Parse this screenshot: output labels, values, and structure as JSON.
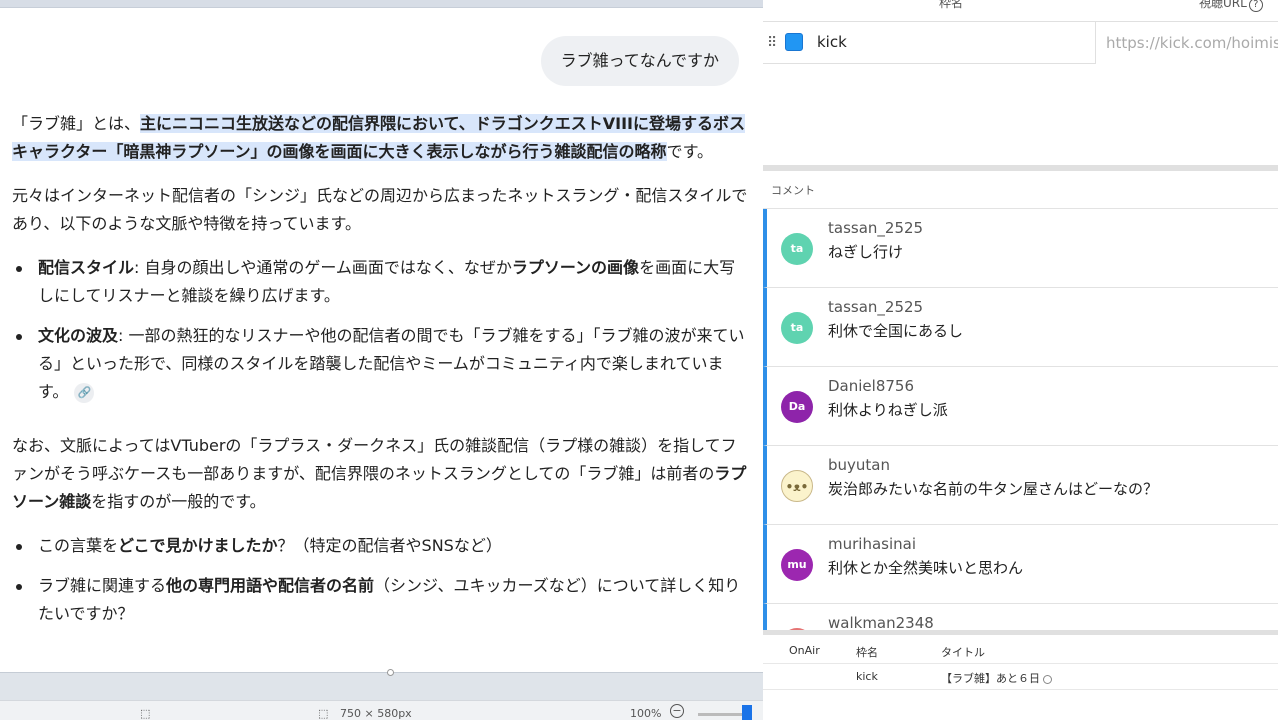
{
  "chat": {
    "user_message": "ラブ雑ってなんですか",
    "answer": {
      "p1_pre": "「ラブ雑」とは、",
      "p1_highlight": "主にニコニコ生放送などの配信界隈において、ドラゴンクエストVIIIに登場するボスキャラクター「暗黒神ラプソーン」の画像を画面に大きく表示しながら行う雑談配信の略称",
      "p1_post": "です。",
      "p2": "元々はインターネット配信者の「シンジ」氏などの周辺から広まったネットスラング・配信スタイルであり、以下のような文脈や特徴を持っています。",
      "b1_label": "配信スタイル",
      "b1_text_a": ": 自身の顔出しや通常のゲーム画面ではなく、なぜか",
      "b1_bold": "ラプソーンの画像",
      "b1_text_b": "を画面に大写しにしてリスナーと雑談を繰り広げます。",
      "b2_label": "文化の波及",
      "b2_text": ": 一部の熱狂的なリスナーや他の配信者の間でも「ラブ雑をする」「ラブ雑の波が来ている」といった形で、同様のスタイルを踏襲した配信やミームがコミュニティ内で楽しまれています。",
      "p3_a": "なお、文脈によってはVTuberの「ラプラス・ダークネス」氏の雑談配信（ラプ様の雑談）を指してファンがそう呼ぶケースも一部ありますが、配信界隈のネットスラングとしての「ラブ雑」は前者の",
      "p3_bold": "ラプソーン雑談",
      "p3_b": "を指すのが一般的です。",
      "q1_a": "この言葉を",
      "q1_bold": "どこで見かけましたか",
      "q1_b": "？（特定の配信者やSNSなど）",
      "q2_a": "ラブ雑に関連する",
      "q2_bold": "他の専門用語や配信者の名前",
      "q2_b": "（シンジ、ユキッカーズなど）について詳しく知りたいですか？"
    }
  },
  "statusbar": {
    "dimensions": "750 × 580px",
    "zoom": "100%"
  },
  "stream_tool": {
    "frame_header": {
      "name_col": "枠名",
      "url_col": "視聴URL"
    },
    "frame": {
      "name": "kick",
      "url_placeholder": "https://kick.com/hoimis"
    },
    "comment_section_label": "コメント",
    "comments": [
      {
        "user": "tassan_2525",
        "text": "ねぎし行け",
        "avatar": "ta",
        "color": "#5fd3b0"
      },
      {
        "user": "tassan_2525",
        "text": "利休で全国にあるし",
        "avatar": "ta",
        "color": "#5fd3b0"
      },
      {
        "user": "Daniel8756",
        "text": "利休よりねぎし派",
        "avatar": "Da",
        "color": "#8e24aa"
      },
      {
        "user": "buyutan",
        "text": "炭治郎みたいな名前の牛タン屋さんはどーなの？",
        "avatar": "face",
        "color": "#fbf3cc"
      },
      {
        "user": "murihasinai",
        "text": "利休とか全然美味いと思わん",
        "avatar": "mu",
        "color": "#9c27b0"
      },
      {
        "user": "walkman2348",
        "text": "",
        "avatar": "",
        "color": "#e57373"
      }
    ],
    "schedule": {
      "headers": [
        "OnAir",
        "枠名",
        "タイトル"
      ],
      "row": {
        "onair": "",
        "name": "kick",
        "title": "【ラブ雑】あと６日"
      }
    }
  }
}
